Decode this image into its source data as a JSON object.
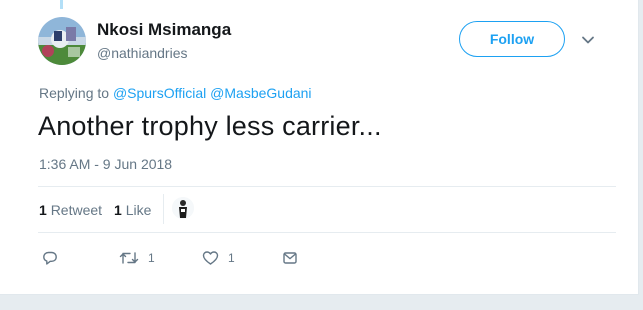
{
  "tweet": {
    "author_name": "Nkosi Msimanga",
    "author_handle": "@nathiandries",
    "follow_label": "Follow",
    "replying_prefix": "Replying to",
    "replying_mentions": [
      "@SpursOfficial",
      "@MasbeGudani"
    ],
    "text": "Another trophy less carrier...",
    "timestamp": "1:36 AM - 9 Jun 2018",
    "retweet_count": "1",
    "retweet_label": "Retweet",
    "like_count": "1",
    "like_label": "Like"
  },
  "actions": {
    "reply_icon": "reply-icon",
    "retweet_icon": "retweet-icon",
    "retweet_count": "1",
    "like_icon": "heart-icon",
    "like_count": "1",
    "dm_icon": "envelope-icon"
  },
  "colors": {
    "accent": "#1da1f2",
    "muted": "#657786",
    "text": "#14171a",
    "page_background": "#e6ecf0"
  }
}
